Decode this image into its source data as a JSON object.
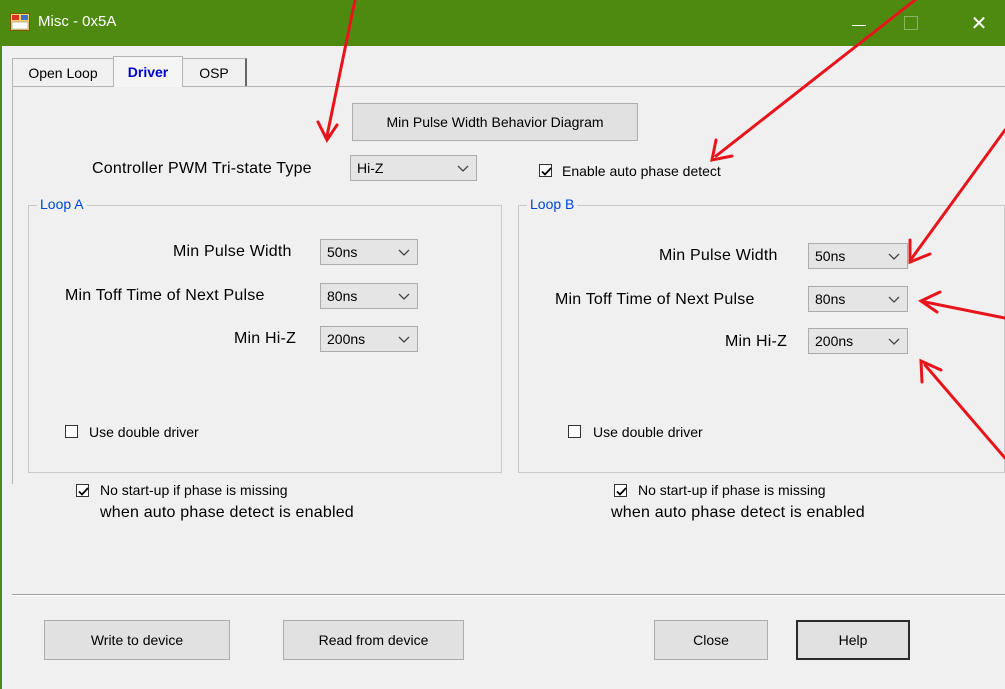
{
  "window": {
    "title": "Misc - 0x5A",
    "accent_color": "#4f8a10",
    "icons": [
      "app-icon",
      "minimize-icon",
      "maximize-icon",
      "close-icon"
    ],
    "close_glyph": "✕"
  },
  "tabs": [
    {
      "label": "Open Loop",
      "active": false
    },
    {
      "label": "Driver",
      "active": true
    },
    {
      "label": "OSP",
      "active": false
    }
  ],
  "driver": {
    "diagram_button": "Min Pulse Width Behavior Diagram",
    "tristate_label": "Controller PWM Tri-state Type",
    "tristate_value": "Hi-Z",
    "auto_phase_label": "Enable auto phase detect",
    "auto_phase_checked": true
  },
  "loops": [
    {
      "title": "Loop A",
      "min_pulse_label": "Min Pulse Width",
      "min_pulse_value": "50ns",
      "min_toff_label": "Min Toff Time of Next Pulse",
      "min_toff_value": "80ns",
      "min_hiz_label": "Min Hi-Z",
      "min_hiz_value": "200ns",
      "double_driver_label": "Use double driver",
      "double_driver_checked": false,
      "no_startup_label": "No start-up if phase is missing",
      "no_startup_label2": "when auto phase detect is enabled",
      "no_startup_checked": true
    },
    {
      "title": "Loop B",
      "min_pulse_label": "Min Pulse Width",
      "min_pulse_value": "50ns",
      "min_toff_label": "Min Toff Time of Next Pulse",
      "min_toff_value": "80ns",
      "min_hiz_label": "Min Hi-Z",
      "min_hiz_value": "200ns",
      "double_driver_label": "Use double driver",
      "double_driver_checked": false,
      "no_startup_label": "No start-up if phase is missing",
      "no_startup_label2": "when auto phase detect is enabled",
      "no_startup_checked": true
    }
  ],
  "footer": {
    "write_label": "Write to device",
    "read_label": "Read from device",
    "close_label": "Close",
    "help_label": "Help"
  },
  "annotation": {
    "arrow_color": "#e8141c"
  }
}
